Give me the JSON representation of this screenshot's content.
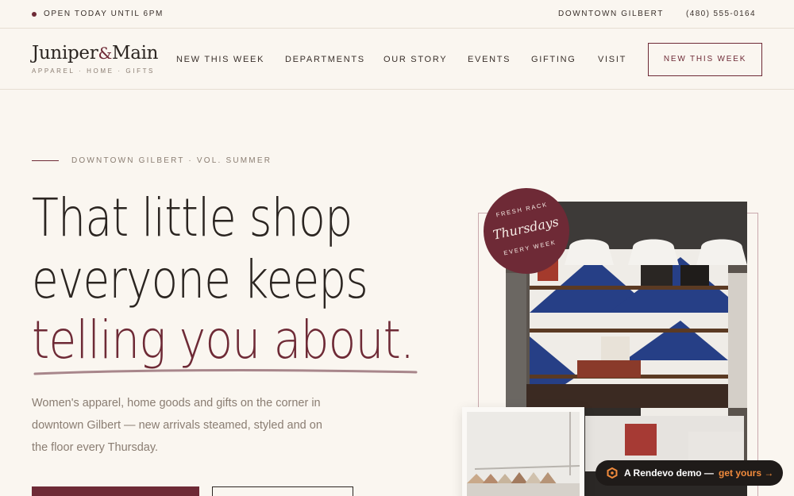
{
  "topbar": {
    "status": "OPEN TODAY UNTIL 6PM",
    "location": "DOWNTOWN GILBERT",
    "phone": "(480) 555-0164"
  },
  "brand": {
    "name_part1": "Juniper",
    "ampersand": "&",
    "name_part2": "Main",
    "tagline": "APPAREL · HOME · GIFTS"
  },
  "nav": {
    "links": [
      "NEW THIS WEEK",
      "DEPARTMENTS",
      "OUR STORY",
      "EVENTS",
      "GIFTING",
      "VISIT"
    ],
    "cta": "NEW THIS WEEK"
  },
  "hero": {
    "eyebrow": "DOWNTOWN GILBERT · VOL. SUMMER",
    "headline_line1": "That little shop",
    "headline_line2": "everyone keeps",
    "headline_line3": "telling you about.",
    "subtext": "Women's apparel, home goods and gifts on the corner in downtown Gilbert — new arrivals steamed, styled and on the floor every Thursday."
  },
  "badge": {
    "top": "FRESH RACK",
    "main": "Thursdays",
    "bottom": "EVERY WEEK"
  },
  "demo_pill": {
    "text": "A Rendevo demo —",
    "cta": "get yours →"
  },
  "colors": {
    "accent": "#6e2a36",
    "background": "#faf6f0",
    "text": "#2b2521",
    "muted": "#8a7d72",
    "pill_cta": "#f08a3c"
  },
  "icons": {
    "status_dot": "dot-icon",
    "pill_logo": "rendevo-logo-icon"
  }
}
